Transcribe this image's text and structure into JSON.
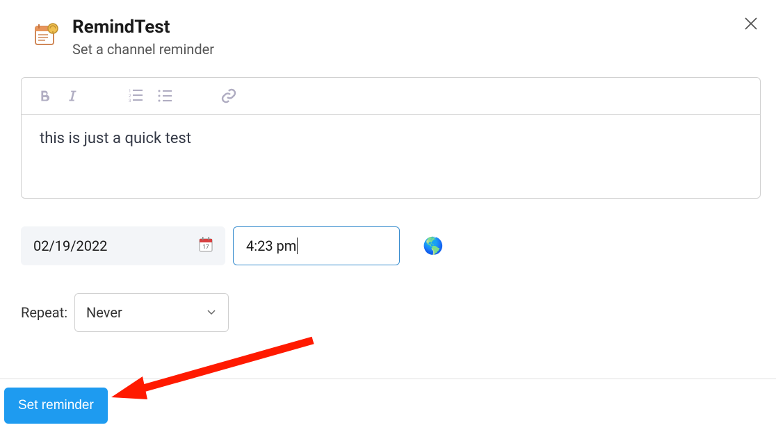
{
  "header": {
    "title": "RemindTest",
    "subtitle": "Set a channel reminder"
  },
  "editor": {
    "content": "this is just a quick test"
  },
  "date": {
    "value": "02/19/2022",
    "icon": "📅"
  },
  "time": {
    "value": "4:23 pm"
  },
  "globe": "🌎",
  "repeat": {
    "label": "Repeat:",
    "selected": "Never"
  },
  "footer": {
    "primary": "Set reminder"
  }
}
